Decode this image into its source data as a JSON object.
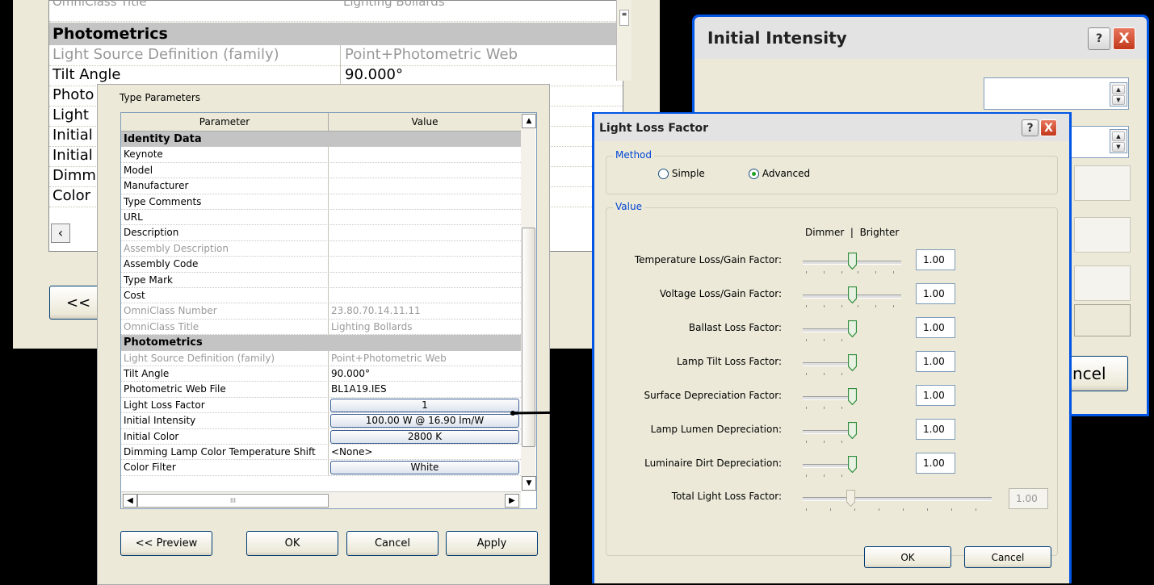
{
  "back_window": {
    "partial_title": "OmniClass Title",
    "partial_value": "Lighting Bollards",
    "section": "Photometrics",
    "rows": [
      {
        "param": "Light Source Definition (family)",
        "value": "Point+Photometric Web"
      },
      {
        "param": "Tilt Angle",
        "value": "90.000°"
      },
      {
        "param": "Photo",
        "value": ""
      },
      {
        "param": "Light",
        "value": ""
      },
      {
        "param": "Initial",
        "value": ""
      },
      {
        "param": "Initial",
        "value": ""
      },
      {
        "param": "Dimmi",
        "value": ""
      },
      {
        "param": "Color",
        "value": ""
      }
    ],
    "preview_partial": "<<"
  },
  "initial_intensity": {
    "title": "Initial Intensity",
    "help": "?",
    "close": "X",
    "cancel_partial": "ncel"
  },
  "type_parameters": {
    "title": "Type Parameters",
    "col_param": "Parameter",
    "col_value": "Value",
    "rows": [
      {
        "param": "Identity Data",
        "value": "",
        "group": true
      },
      {
        "param": "Keynote",
        "value": ""
      },
      {
        "param": "Model",
        "value": ""
      },
      {
        "param": "Manufacturer",
        "value": ""
      },
      {
        "param": "Type Comments",
        "value": ""
      },
      {
        "param": "URL",
        "value": ""
      },
      {
        "param": "Description",
        "value": ""
      },
      {
        "param": "Assembly Description",
        "value": "",
        "grey": true
      },
      {
        "param": "Assembly Code",
        "value": ""
      },
      {
        "param": "Type Mark",
        "value": ""
      },
      {
        "param": "Cost",
        "value": ""
      },
      {
        "param": "OmniClass Number",
        "value": "23.80.70.14.11.11",
        "grey": true
      },
      {
        "param": "OmniClass Title",
        "value": "Lighting Bollards",
        "grey": true
      },
      {
        "param": "Photometrics",
        "value": "",
        "group": true
      },
      {
        "param": "Light Source Definition (family)",
        "value": "Point+Photometric Web",
        "grey": true
      },
      {
        "param": "Tilt Angle",
        "value": "90.000°"
      },
      {
        "param": "Photometric Web File",
        "value": "BL1A19.IES"
      },
      {
        "param": "Light Loss Factor",
        "value": "1",
        "button": true
      },
      {
        "param": "Initial Intensity",
        "value": "100.00 W @ 16.90 lm/W",
        "button": true
      },
      {
        "param": "Initial Color",
        "value": "2800 K",
        "button": true
      },
      {
        "param": "Dimming Lamp Color Temperature Shift",
        "value": "<None>"
      },
      {
        "param": "Color Filter",
        "value": "White",
        "button": true
      }
    ],
    "buttons": {
      "preview": "<< Preview",
      "ok": "OK",
      "cancel": "Cancel",
      "apply": "Apply"
    },
    "scroll_mid": "III"
  },
  "llf": {
    "title": "Light Loss Factor",
    "help": "?",
    "close": "X",
    "method_legend": "Method",
    "simple": "Simple",
    "advanced": "Advanced",
    "value_legend": "Value",
    "dimmer_brighter": "Dimmer  |  Brighter",
    "factors": [
      {
        "label": "Temperature Loss/Gain Factor:",
        "value": "1.00"
      },
      {
        "label": "Voltage Loss/Gain Factor:",
        "value": "1.00"
      },
      {
        "label": "Ballast Loss Factor:",
        "value": "1.00"
      },
      {
        "label": "Lamp Tilt Loss Factor:",
        "value": "1.00"
      },
      {
        "label": "Surface Depreciation Factor:",
        "value": "1.00"
      },
      {
        "label": "Lamp Lumen  Depreciation:",
        "value": "1.00"
      },
      {
        "label": "Luminaire Dirt  Depreciation:",
        "value": "1.00"
      }
    ],
    "total_label": "Total Light Loss Factor:",
    "total_value": "1.00",
    "ok": "OK",
    "cancel": "Cancel"
  },
  "colors": {
    "xp_blue": "#0058e6",
    "window_bg": "#ece9d8",
    "group_header": "#c4c4c4",
    "arrow": "#000000"
  }
}
